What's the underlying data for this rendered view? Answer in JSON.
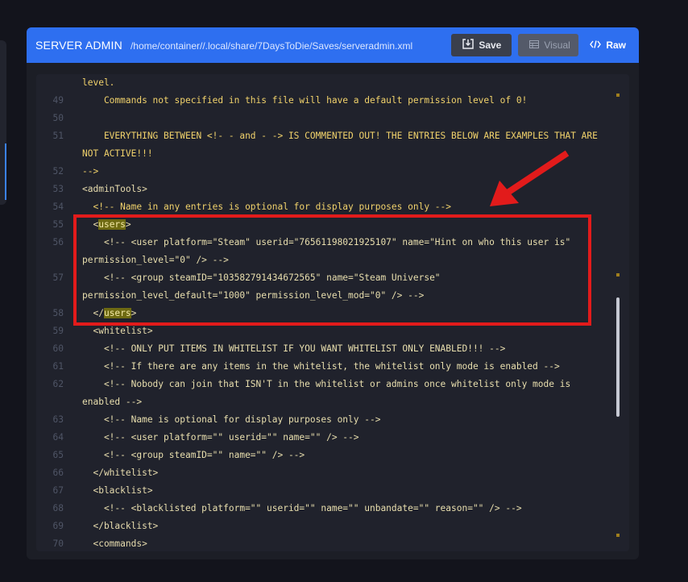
{
  "header": {
    "title": "SERVER ADMIN",
    "path": "/home/container//.local/share/7DaysToDie/Saves/serveradmin.xml",
    "save_label": "Save",
    "visual_label": "Visual",
    "raw_label": "Raw"
  },
  "editor": {
    "lines": [
      {
        "num": "",
        "text": "level.",
        "kind": "comment"
      },
      {
        "num": "49",
        "text": "    Commands not specified in this file will have a default permission level of 0!",
        "kind": "comment"
      },
      {
        "num": "50",
        "text": "",
        "kind": "comment"
      },
      {
        "num": "51",
        "text": "    EVERYTHING BETWEEN <!- - and - -> IS COMMENTED OUT! THE ENTRIES BELOW ARE EXAMPLES THAT ARE",
        "kind": "comment"
      },
      {
        "num": "",
        "text": "NOT ACTIVE!!!",
        "kind": "comment"
      },
      {
        "num": "52",
        "text": "-->",
        "kind": "comment"
      },
      {
        "num": "53",
        "text": "<adminTools>",
        "kind": "tag"
      },
      {
        "num": "54",
        "text": "  <!-- Name in any entries is optional for display purposes only -->",
        "kind": "comment"
      },
      {
        "num": "55",
        "text": "  <users>",
        "kind": "tag",
        "hl_pre": "  <",
        "hl": "users",
        "hl_post": ">"
      },
      {
        "num": "56",
        "text": "    <!-- <user platform=\"Steam\" userid=\"76561198021925107\" name=\"Hint on who this user is\"",
        "kind": "text"
      },
      {
        "num": "",
        "text": "permission_level=\"0\" /> -->",
        "kind": "text"
      },
      {
        "num": "57",
        "text": "    <!-- <group steamID=\"103582791434672565\" name=\"Steam Universe\"",
        "kind": "text"
      },
      {
        "num": "",
        "text": "permission_level_default=\"1000\" permission_level_mod=\"0\" /> -->",
        "kind": "text"
      },
      {
        "num": "58",
        "text": "  </users>",
        "kind": "tag",
        "hl_pre": "  </",
        "hl": "users",
        "hl_post": ">"
      },
      {
        "num": "59",
        "text": "  <whitelist>",
        "kind": "tag"
      },
      {
        "num": "60",
        "text": "    <!-- ONLY PUT ITEMS IN WHITELIST IF YOU WANT WHITELIST ONLY ENABLED!!! -->",
        "kind": "text"
      },
      {
        "num": "61",
        "text": "    <!-- If there are any items in the whitelist, the whitelist only mode is enabled -->",
        "kind": "text"
      },
      {
        "num": "62",
        "text": "    <!-- Nobody can join that ISN'T in the whitelist or admins once whitelist only mode is",
        "kind": "text"
      },
      {
        "num": "",
        "text": "enabled -->",
        "kind": "text"
      },
      {
        "num": "63",
        "text": "    <!-- Name is optional for display purposes only -->",
        "kind": "text"
      },
      {
        "num": "64",
        "text": "    <!-- <user platform=\"\" userid=\"\" name=\"\" /> -->",
        "kind": "text"
      },
      {
        "num": "65",
        "text": "    <!-- <group steamID=\"\" name=\"\" /> -->",
        "kind": "text"
      },
      {
        "num": "66",
        "text": "  </whitelist>",
        "kind": "tag"
      },
      {
        "num": "67",
        "text": "  <blacklist>",
        "kind": "tag"
      },
      {
        "num": "68",
        "text": "    <!-- <blacklisted platform=\"\" userid=\"\" name=\"\" unbandate=\"\" reason=\"\" /> -->",
        "kind": "text"
      },
      {
        "num": "69",
        "text": "  </blacklist>",
        "kind": "tag"
      },
      {
        "num": "70",
        "text": "  <commands>",
        "kind": "tag"
      }
    ]
  },
  "icons": {
    "save": "save-download-icon",
    "visual": "table-icon",
    "raw": "code-icon"
  },
  "colors": {
    "header": "#2e6ff0",
    "annotation": "#e21b1b",
    "comment": "#f1d26b"
  }
}
